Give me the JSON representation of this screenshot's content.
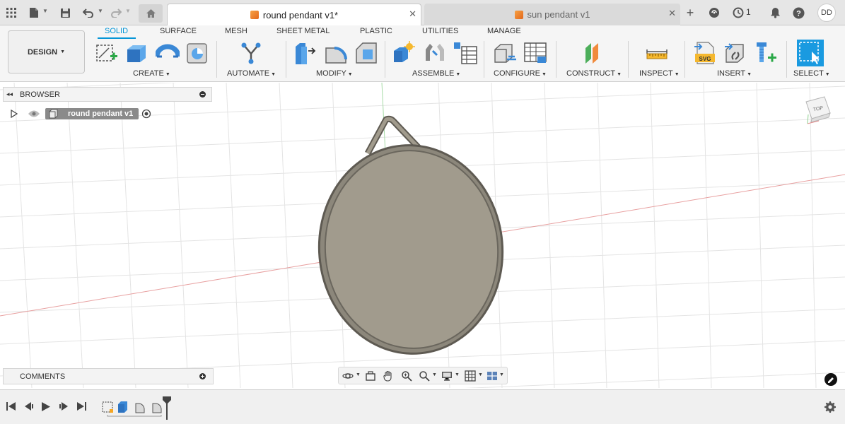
{
  "topbar": {
    "tabs": [
      {
        "label": "round pendant v1*",
        "active": true
      },
      {
        "label": "sun pendant v1",
        "active": false
      }
    ],
    "jobs_count": "1",
    "user_initials": "DD"
  },
  "toolbar": {
    "workspace_button": "DESIGN",
    "workspace_tabs": [
      "SOLID",
      "SURFACE",
      "MESH",
      "SHEET METAL",
      "PLASTIC",
      "UTILITIES",
      "MANAGE"
    ],
    "groups": [
      "CREATE",
      "AUTOMATE",
      "MODIFY",
      "ASSEMBLE",
      "CONFIGURE",
      "CONSTRUCT",
      "INSPECT",
      "INSERT",
      "SELECT"
    ]
  },
  "browser": {
    "title": "BROWSER",
    "root_component": "round pendant v1"
  },
  "comments": {
    "title": "COMMENTS"
  },
  "viewcube": {
    "face": "TOP"
  },
  "colors": {
    "accent": "#0696d7",
    "pendant_face": "#a19b8d",
    "pendant_rim": "#5e5a52",
    "x_axis": "#e8a0a0",
    "y_axis": "#a6dba6"
  }
}
